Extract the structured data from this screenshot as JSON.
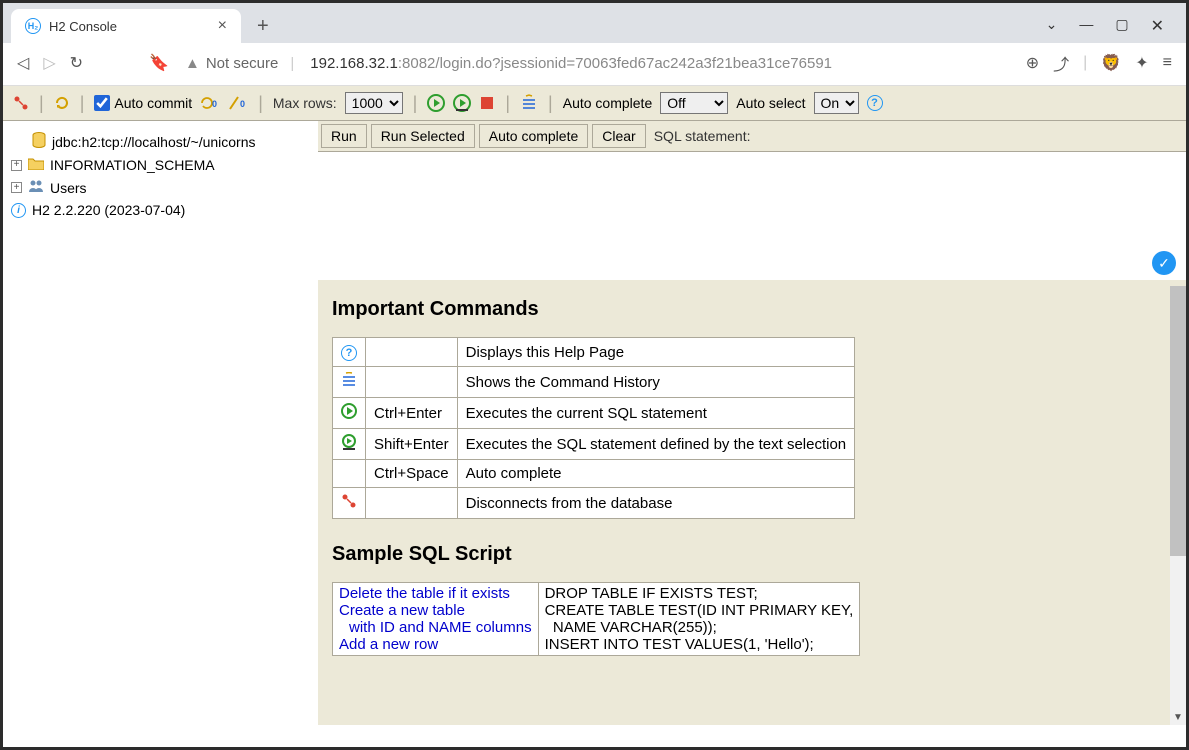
{
  "browser": {
    "tab_title": "H2 Console",
    "not_secure_label": "Not secure",
    "url_host": "192.168.32.1",
    "url_port": ":8082",
    "url_path": "/login.do?jsessionid=70063fed67ac242a3f21bea31ce76591"
  },
  "toolbar": {
    "auto_commit_label": "Auto commit",
    "max_rows_label": "Max rows:",
    "max_rows_value": "1000",
    "auto_complete_label": "Auto complete",
    "auto_complete_value": "Off",
    "auto_select_label": "Auto select",
    "auto_select_value": "On"
  },
  "sidebar": {
    "db_url": "jdbc:h2:tcp://localhost/~/unicorns",
    "info_schema": "INFORMATION_SCHEMA",
    "users_label": "Users",
    "version_label": "H2 2.2.220 (2023-07-04)"
  },
  "sql": {
    "run_label": "Run",
    "run_selected_label": "Run Selected",
    "auto_complete_label": "Auto complete",
    "clear_label": "Clear",
    "statement_label": "SQL statement:"
  },
  "results": {
    "commands_heading": "Important Commands",
    "commands": [
      {
        "shortcut": "",
        "desc": "Displays this Help Page"
      },
      {
        "shortcut": "",
        "desc": "Shows the Command History"
      },
      {
        "shortcut": "Ctrl+Enter",
        "desc": "Executes the current SQL statement"
      },
      {
        "shortcut": "Shift+Enter",
        "desc": "Executes the SQL statement defined by the text selection"
      },
      {
        "shortcut": "Ctrl+Space",
        "desc": "Auto complete"
      },
      {
        "shortcut": "",
        "desc": "Disconnects from the database"
      }
    ],
    "sample_heading": "Sample SQL Script",
    "sample_links": {
      "l1": "Delete the table if it exists",
      "l2": "Create a new table",
      "l2sub": "with ID and NAME columns",
      "l3": "Add a new row"
    },
    "sample_code": "DROP TABLE IF EXISTS TEST;\nCREATE TABLE TEST(ID INT PRIMARY KEY,\n  NAME VARCHAR(255));\nINSERT INTO TEST VALUES(1, 'Hello');"
  }
}
